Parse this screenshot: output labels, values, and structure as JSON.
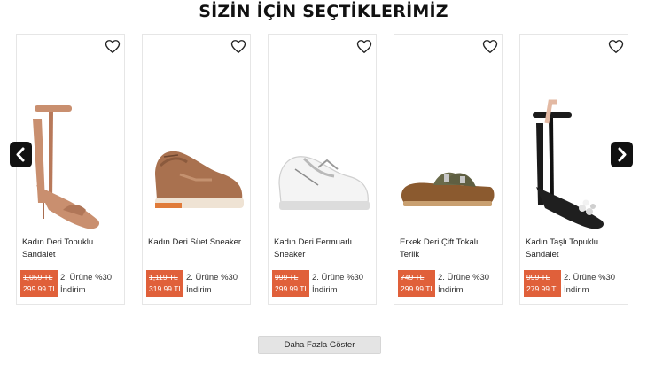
{
  "section_title": "SİZİN İÇİN SEÇTİKLERİMİZ",
  "products": [
    {
      "name": "Kadın Deri Topuklu Sandalet",
      "old_price": "1,059 TL",
      "new_price": "299.99 TL",
      "promo": "2. Ürüne %30 İndirim",
      "icon": "heart-outline-icon"
    },
    {
      "name": "Kadın Deri Süet Sneaker",
      "old_price": "1,119 TL",
      "new_price": "319.99 TL",
      "promo": "2. Ürüne %30 İndirim",
      "icon": "heart-outline-icon"
    },
    {
      "name": "Kadın Deri Fermuarlı Sneaker",
      "old_price": "999 TL",
      "new_price": "299.99 TL",
      "promo": "2. Ürüne %30 İndirim",
      "icon": "heart-outline-icon"
    },
    {
      "name": "Erkek Deri Çift Tokalı Terlik",
      "old_price": "749 TL",
      "new_price": "299.99 TL",
      "promo": "2. Ürüne %30 İndirim",
      "icon": "heart-outline-icon"
    },
    {
      "name": "Kadın Taşlı Topuklu Sandalet",
      "old_price": "999 TL",
      "new_price": "279.99 TL",
      "promo": "2. Ürüne %30 İndirim",
      "icon": "heart-outline-icon"
    }
  ],
  "nav": {
    "prev_icon": "chevron-left-icon",
    "next_icon": "chevron-right-icon"
  },
  "load_more_label": "Daha Fazla Göster",
  "colors": {
    "price_badge": "#e0603a",
    "arrow_bg": "#111111",
    "button_bg": "#e4e4e4"
  }
}
